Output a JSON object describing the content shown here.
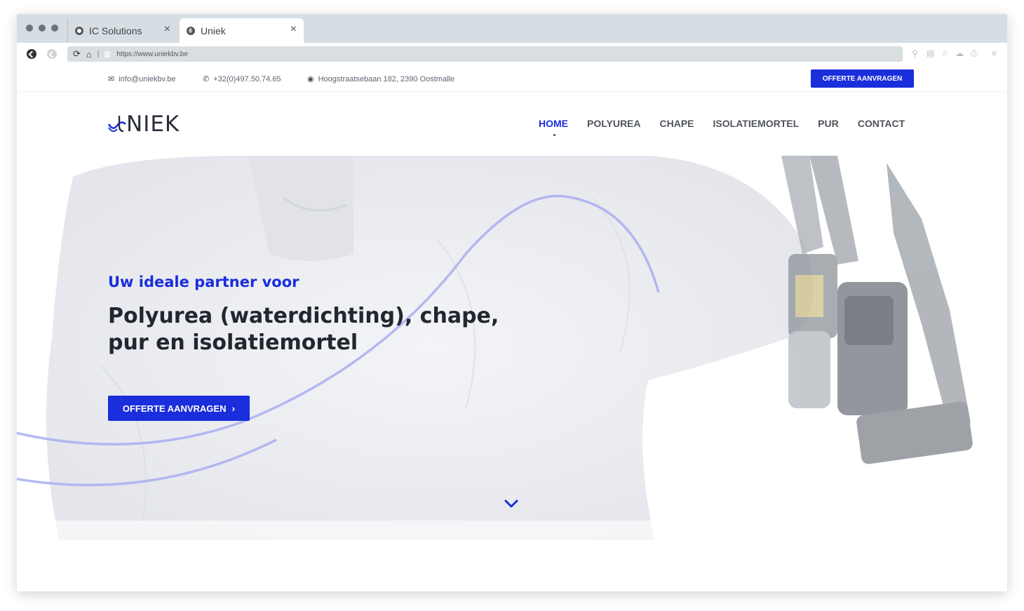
{
  "browser": {
    "tabs": [
      {
        "label": "IC Solutions",
        "close": "×"
      },
      {
        "label": "Uniek",
        "close": "×"
      }
    ],
    "url": "https://www.uniekbv.be"
  },
  "topbar": {
    "email": "info@uniekbv.be",
    "phone": "+32(0)497.50.74.65",
    "address": "Hoogstraatsebaan 182, 2390 Oostmalle",
    "cta_label": "OFFERTE AANVRAGEN"
  },
  "header": {
    "logo_text": "NIEK",
    "logo_alt": "UNIEK",
    "nav": [
      {
        "label": "HOME",
        "active": true
      },
      {
        "label": "POLYUREA",
        "active": false
      },
      {
        "label": "CHAPE",
        "active": false
      },
      {
        "label": "ISOLATIEMORTEL",
        "active": false
      },
      {
        "label": "PUR",
        "active": false
      },
      {
        "label": "CONTACT",
        "active": false
      }
    ]
  },
  "hero": {
    "subtitle": "Uw ideale partner voor",
    "title_line1": "Polyurea (waterdichting), chape,",
    "title_line2": "pur en isolatiemortel",
    "cta_label": "OFFERTE AANVRAGEN",
    "cta_icon": "chevron-right-icon",
    "scroll_icon": "chevron-down-icon"
  },
  "colors": {
    "accent": "#1a2edb",
    "text_dark": "#23262f",
    "text_muted": "#5d6470"
  }
}
